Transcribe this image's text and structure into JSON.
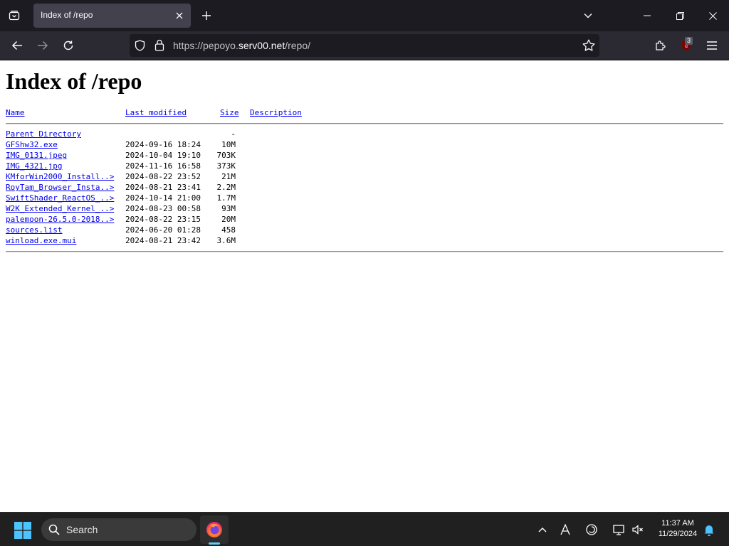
{
  "browser": {
    "tab_title": "Index of /repo",
    "url_scheme": "https://pepoyo.",
    "url_host": "serv00.net",
    "url_path": "/repo/",
    "extension_badge": "3"
  },
  "page": {
    "heading": "Index of /repo",
    "columns": {
      "name": "Name",
      "last_modified": "Last modified",
      "size": "Size",
      "description": "Description"
    },
    "parent": {
      "name": "Parent Directory",
      "size": "-"
    },
    "files": [
      {
        "name": "GFShw32.exe",
        "date": "2024-09-16 18:24",
        "size": "10M"
      },
      {
        "name": "IMG_0131.jpeg",
        "date": "2024-10-04 19:10",
        "size": "703K"
      },
      {
        "name": "IMG_4321.jpg",
        "date": "2024-11-16 16:58",
        "size": "373K"
      },
      {
        "name": "KMforWin2000_Install..>",
        "date": "2024-08-22 23:52",
        "size": "21M"
      },
      {
        "name": "RoyTam_Browser_Insta..>",
        "date": "2024-08-21 23:41",
        "size": "2.2M"
      },
      {
        "name": "SwiftShader_ReactOS_..>",
        "date": "2024-10-14 21:00",
        "size": "1.7M"
      },
      {
        "name": "W2K_Extended_Kernel_..>",
        "date": "2024-08-23 00:58",
        "size": "93M"
      },
      {
        "name": "palemoon-26.5.0-2018..>",
        "date": "2024-08-22 23:15",
        "size": "20M"
      },
      {
        "name": "sources.list",
        "date": "2024-06-20 01:28",
        "size": "458"
      },
      {
        "name": "winload.exe.mui",
        "date": "2024-08-21 23:42",
        "size": "3.6M"
      }
    ]
  },
  "taskbar": {
    "search_label": "Search",
    "time": "11:37 AM",
    "date": "11/29/2024"
  },
  "colors": {
    "link": "#0000ee",
    "taskbar_accent": "#60cdff",
    "chrome_dark": "#1c1b22"
  }
}
